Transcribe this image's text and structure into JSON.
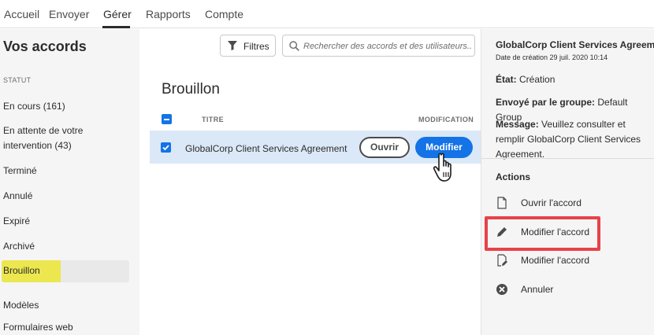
{
  "nav": {
    "tabs": [
      {
        "label": "Accueil"
      },
      {
        "label": "Envoyer"
      },
      {
        "label": "Gérer"
      },
      {
        "label": "Rapports"
      },
      {
        "label": "Compte"
      }
    ],
    "active": "Gérer"
  },
  "left": {
    "title": "Vos accords",
    "status_header": "STATUT",
    "items": [
      {
        "label": "En cours (161)"
      },
      {
        "label": "En attente de votre intervention (43)"
      },
      {
        "label": "Terminé"
      },
      {
        "label": "Annulé"
      },
      {
        "label": "Expiré"
      },
      {
        "label": "Archivé"
      },
      {
        "label": "Brouillon"
      },
      {
        "label": "Modèles"
      },
      {
        "label": "Formulaires web"
      }
    ],
    "selected": "Brouillon",
    "highlight_color": "#ece74f"
  },
  "toolbar": {
    "filters_label": "Filtres",
    "search_placeholder": "Rechercher des accords et des utilisateurs..."
  },
  "main": {
    "title": "Brouillon",
    "columns": {
      "title": "TITRE",
      "modification": "MODIFICATION"
    },
    "rows": [
      {
        "name": "GlobalCorp Client Services Agreement",
        "checked": true,
        "open_label": "Ouvrir",
        "edit_label": "Modifier"
      }
    ]
  },
  "details": {
    "agreement_title": "GlobalCorp Client Services Agreement",
    "created": "Date de création 29 juil. 2020 10:14",
    "state_label": "État:",
    "state_value": "Création",
    "sent_by_label": "Envoyé par le groupe:",
    "sent_by_value": "Default Group",
    "message_label": "Message:",
    "message_value": "Veuillez consulter et remplir GlobalCorp Client Services Agreement.",
    "actions_title": "Actions",
    "actions": [
      {
        "label": "Ouvrir l'accord",
        "icon": "document-icon"
      },
      {
        "label": "Modifier l'accord",
        "icon": "pencil-icon"
      },
      {
        "label": "Modifier l'accord",
        "icon": "document-edit-icon"
      },
      {
        "label": "Annuler",
        "icon": "cancel-circle-icon"
      }
    ]
  },
  "colors": {
    "accent": "#1473e6",
    "row_selected": "#dbe8f7",
    "callout_border": "#e8424a"
  }
}
